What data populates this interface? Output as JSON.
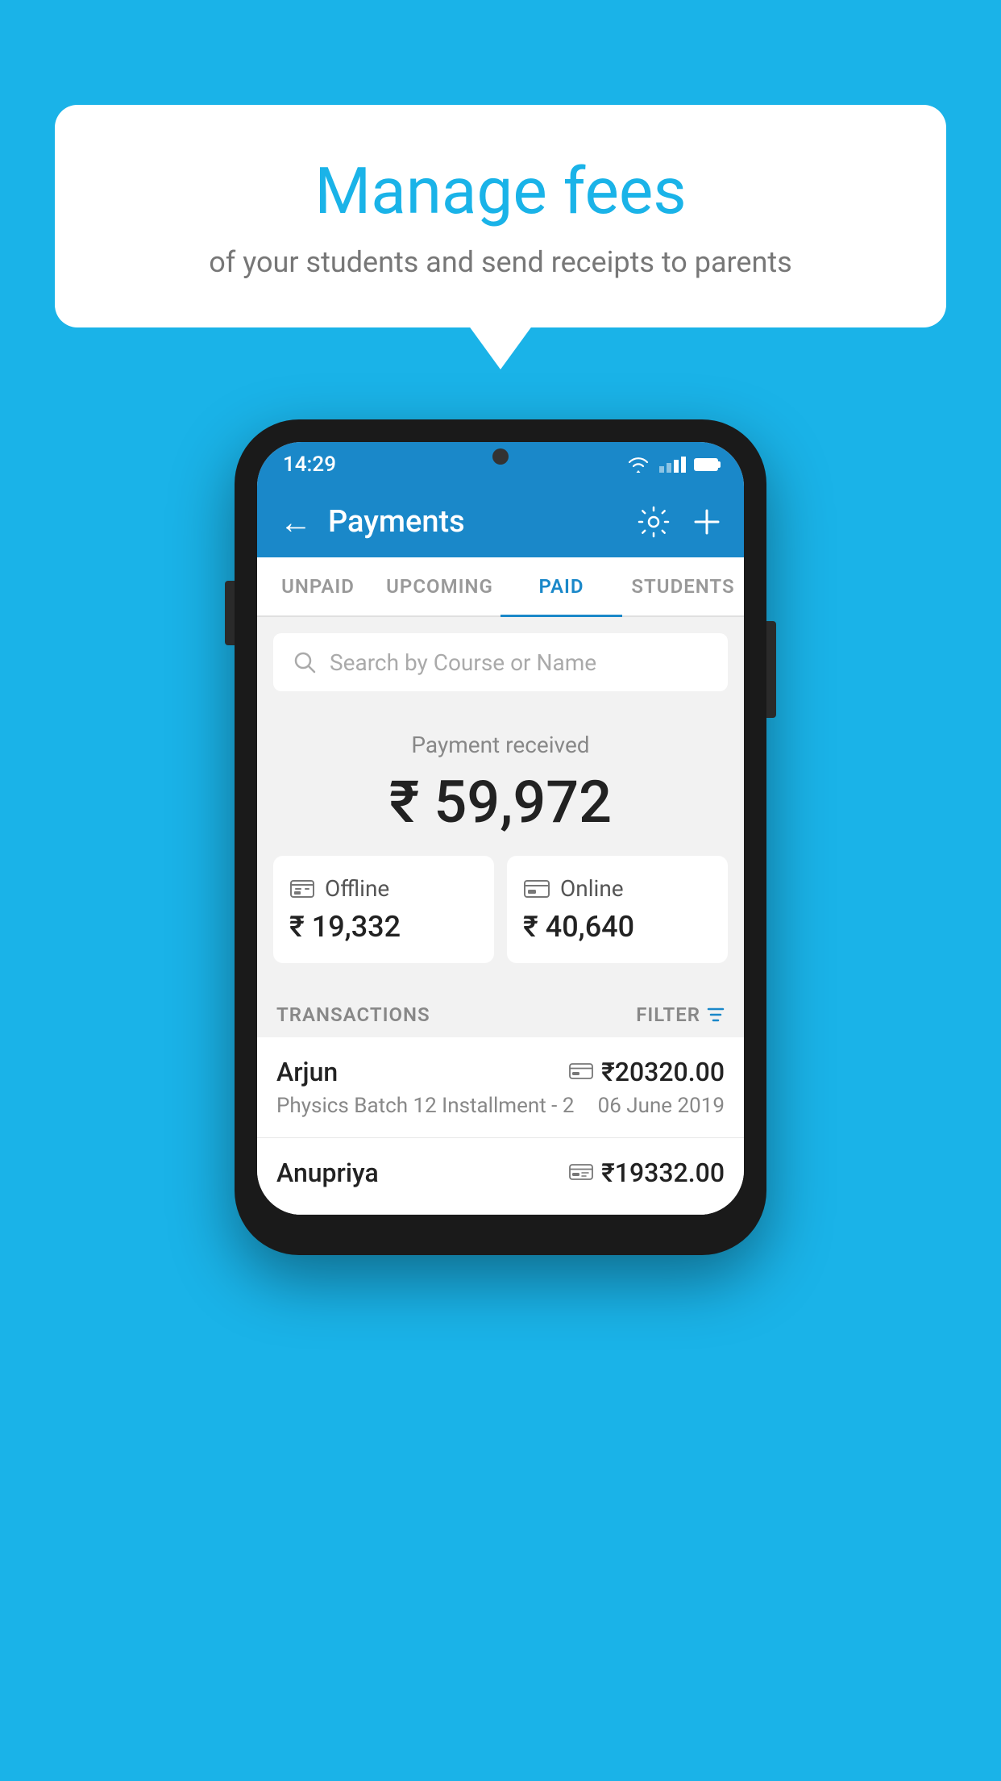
{
  "background_color": "#1ab3e8",
  "bubble": {
    "title": "Manage fees",
    "subtitle": "of your students and send receipts to parents"
  },
  "status_bar": {
    "time": "14:29",
    "wifi_icon": "wifi-icon",
    "signal_icon": "signal-icon",
    "battery_icon": "battery-icon"
  },
  "app_bar": {
    "title": "Payments",
    "back_label": "←",
    "settings_icon": "gear-icon",
    "add_icon": "plus-icon"
  },
  "tabs": [
    {
      "label": "UNPAID",
      "active": false
    },
    {
      "label": "UPCOMING",
      "active": false
    },
    {
      "label": "PAID",
      "active": true
    },
    {
      "label": "STUDENTS",
      "active": false
    }
  ],
  "search": {
    "placeholder": "Search by Course or Name"
  },
  "payment_summary": {
    "received_label": "Payment received",
    "total_amount": "₹ 59,972",
    "offline": {
      "type": "Offline",
      "amount": "₹ 19,332",
      "icon": "offline-payment-icon"
    },
    "online": {
      "type": "Online",
      "amount": "₹ 40,640",
      "icon": "online-payment-icon"
    }
  },
  "transactions": {
    "section_label": "TRANSACTIONS",
    "filter_label": "FILTER",
    "items": [
      {
        "name": "Arjun",
        "course": "Physics Batch 12 Installment - 2",
        "amount": "₹20320.00",
        "date": "06 June 2019",
        "payment_icon": "online-payment-icon"
      },
      {
        "name": "Anupriya",
        "course": "",
        "amount": "₹19332.00",
        "date": "",
        "payment_icon": "offline-payment-icon"
      }
    ]
  }
}
